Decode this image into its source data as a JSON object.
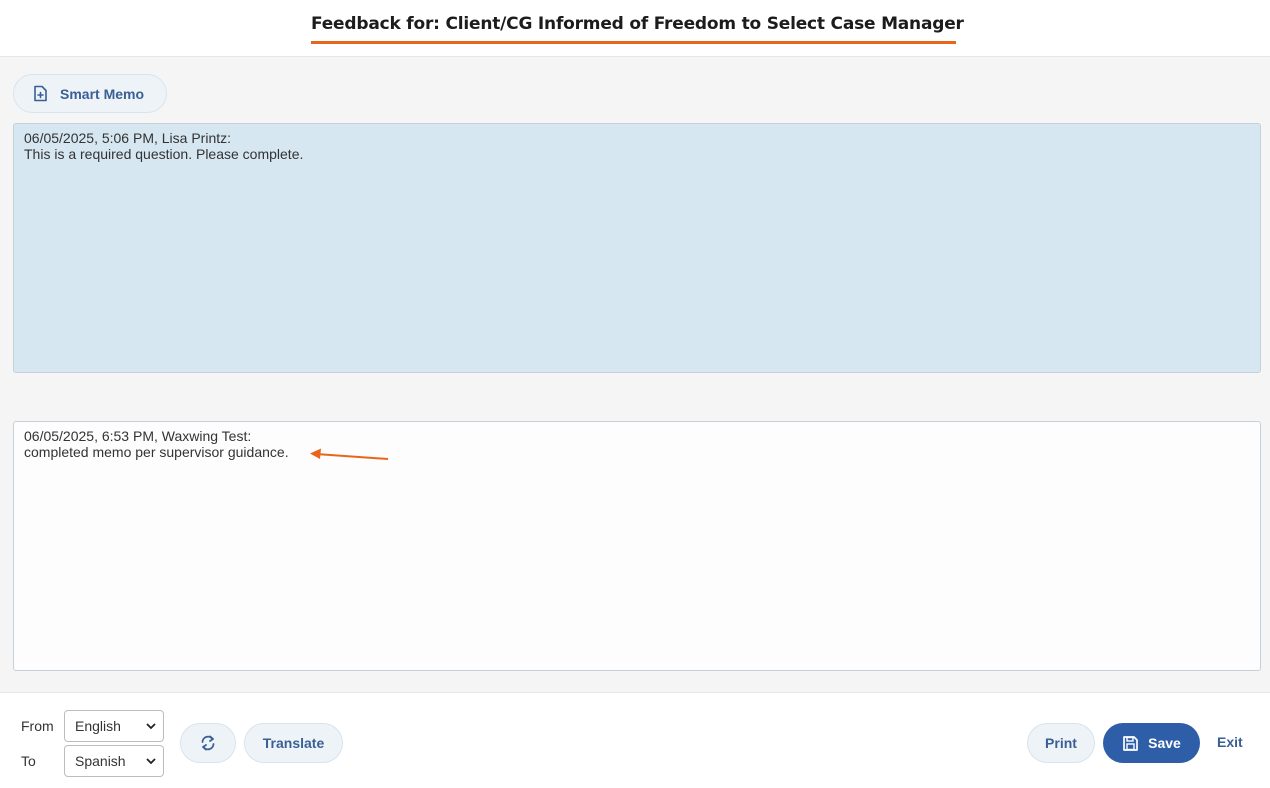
{
  "header": {
    "title": "Feedback for: Client/CG Informed of Freedom to Select Case Manager"
  },
  "toolbar": {
    "smart_memo_label": "Smart Memo"
  },
  "memos": {
    "previous": "06/05/2025, 5:06 PM, Lisa Printz:\nThis is a required question. Please complete.",
    "current": "06/05/2025, 6:53 PM, Waxwing Test:\ncompleted memo per supervisor guidance."
  },
  "annotation": {
    "arrow_color": "#e8661c"
  },
  "footer": {
    "from_label": "From",
    "to_label": "To",
    "from_value": "English",
    "to_value": "Spanish",
    "translate_label": "Translate",
    "print_label": "Print",
    "save_label": "Save",
    "exit_label": "Exit"
  },
  "colors": {
    "accent": "#e8661c",
    "primary": "#2f5ea8",
    "link": "#3a5f95",
    "previous_memo_bg": "#d6e7f1"
  }
}
